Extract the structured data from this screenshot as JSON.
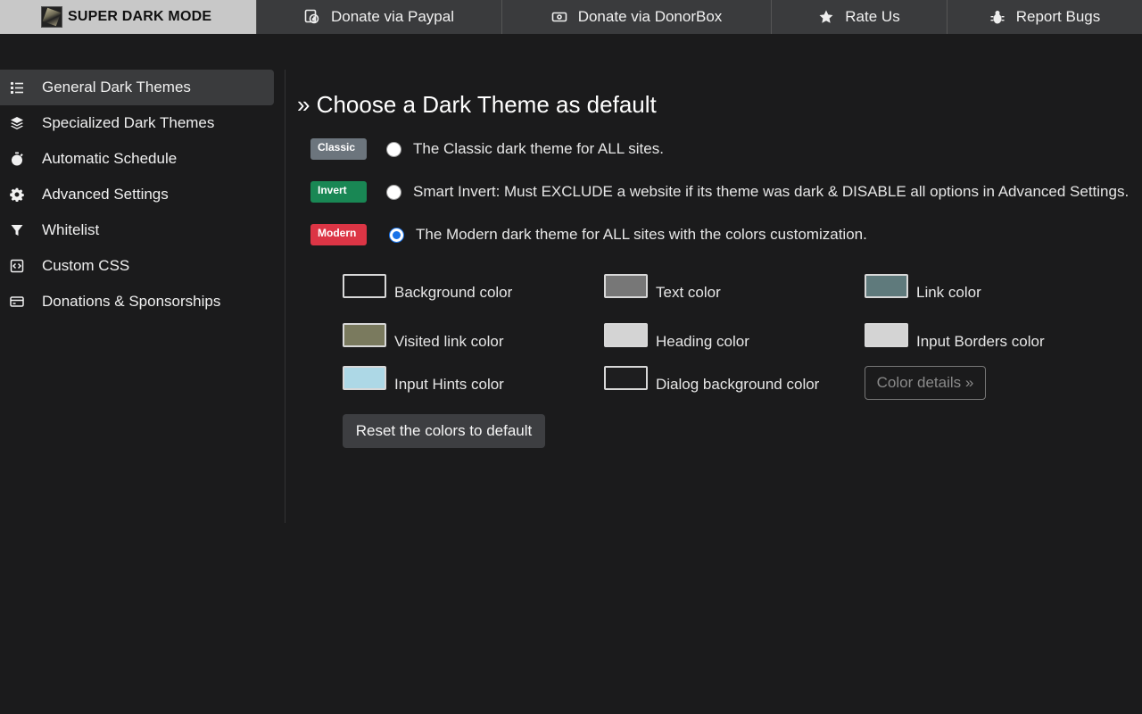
{
  "topnav": {
    "brand": "SUPER DARK MODE",
    "items": [
      {
        "label": "Donate via Paypal",
        "icon": "paypal-icon"
      },
      {
        "label": "Donate via DonorBox",
        "icon": "cash-icon"
      },
      {
        "label": "Rate Us",
        "icon": "star-icon"
      },
      {
        "label": "Report Bugs",
        "icon": "bug-icon"
      }
    ]
  },
  "sidebar": {
    "items": [
      {
        "label": "General Dark Themes",
        "icon": "list-icon",
        "active": true
      },
      {
        "label": "Specialized Dark Themes",
        "icon": "layers-icon"
      },
      {
        "label": "Automatic Schedule",
        "icon": "stopwatch-icon"
      },
      {
        "label": "Advanced Settings",
        "icon": "gear-icon"
      },
      {
        "label": "Whitelist",
        "icon": "filter-icon"
      },
      {
        "label": "Custom CSS",
        "icon": "code-file-icon"
      },
      {
        "label": "Donations & Sponsorships",
        "icon": "credit-card-icon"
      }
    ]
  },
  "main": {
    "title": "» Choose a Dark Theme as default",
    "themes": [
      {
        "badge": "Classic",
        "badge_color": "#6c757d",
        "description": "The Classic dark theme for ALL sites.",
        "selected": false
      },
      {
        "badge": "Invert",
        "badge_color": "#198754",
        "description": "Smart Invert: Must EXCLUDE a website if its theme was dark & DISABLE all options in Advanced Settings.",
        "selected": false
      },
      {
        "badge": "Modern",
        "badge_color": "#dc3545",
        "description": "The Modern dark theme for ALL sites with the colors customization.",
        "selected": true
      }
    ],
    "colors": [
      {
        "label": "Background color",
        "value": "#1b1b1c"
      },
      {
        "label": "Text color",
        "value": "#777777"
      },
      {
        "label": "Link color",
        "value": "#5f7a7c"
      },
      {
        "label": "Visited link color",
        "value": "#7a7a5e"
      },
      {
        "label": "Heading color",
        "value": "#d4d4d4"
      },
      {
        "label": "Input Borders color",
        "value": "#d4d4d4"
      },
      {
        "label": "Input Hints color",
        "value": "#add8e6"
      },
      {
        "label": "Dialog background color",
        "value": "#1e1e1f"
      }
    ],
    "details_label": "Color details »",
    "reset_label": "Reset the colors to default"
  }
}
